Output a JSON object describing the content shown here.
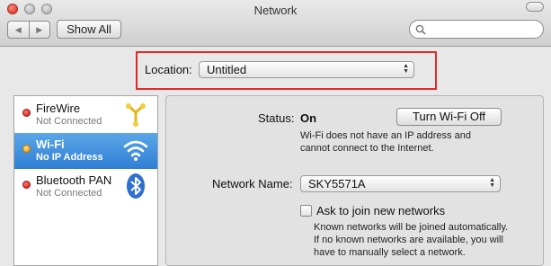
{
  "window": {
    "title": "Network"
  },
  "toolbar": {
    "back_glyph": "◀",
    "forward_glyph": "▶",
    "show_all_label": "Show All",
    "search_placeholder": ""
  },
  "location": {
    "label": "Location:",
    "value": "Untitled",
    "highlight_color": "#e02a2a"
  },
  "services": [
    {
      "name": "FireWire",
      "status": "Not Connected",
      "indicator": "red",
      "icon": "firewire-icon"
    },
    {
      "name": "Wi-Fi",
      "status": "No IP Address",
      "indicator": "amber",
      "icon": "wifi-icon",
      "selected": true
    },
    {
      "name": "Bluetooth PAN",
      "status": "Not Connected",
      "indicator": "red",
      "icon": "bluetooth-icon"
    }
  ],
  "detail": {
    "status_label": "Status:",
    "status_value": "On",
    "turn_off_button": "Turn Wi-Fi Off",
    "status_desc_line1": "Wi-Fi does not have an IP address and",
    "status_desc_line2": "cannot connect to the Internet.",
    "network_name_label": "Network Name:",
    "network_name_value": "SKY5571A",
    "ask_join_label": "Ask to join new networks",
    "ask_join_checked": false,
    "ask_desc_line1": "Known networks will be joined automatically.",
    "ask_desc_line2": "If no known networks are available, you will",
    "ask_desc_line3": "have to manually select a network."
  },
  "colors": {
    "selection": "#2f7fd4",
    "not_connected": "#d62c23",
    "partial": "#f0a81c"
  }
}
